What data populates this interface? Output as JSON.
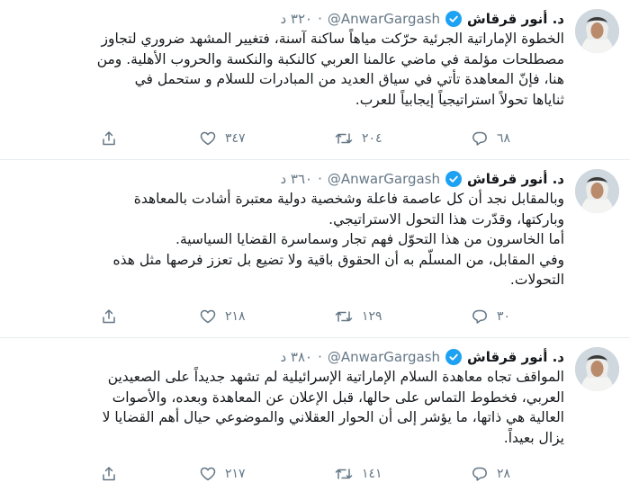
{
  "tweets": [
    {
      "author": {
        "name": "د. أنور قرقاش",
        "handle": "@AnwarGargash"
      },
      "separator": "·",
      "time": "٣٢٠ د",
      "text": "الخطوة الإماراتية الجرئية حرّكت مياهاً ساكنة آسنة، فتغيير المشهد ضروري لتجاوز\nمصطلحات مؤلمة في ماضي عالمنا العربي كالنكبة والنكسة والحروب الأهلية. ومن\nهنا، فإنّ المعاهدة تأتي في سياق العديد من المبادرات للسلام و ستحمل في\nثناياها تحولاً استراتيجياً إيجابياً للعرب.",
      "replies": "٦٨",
      "retweets": "٢٠٤",
      "likes": "٣٤٧"
    },
    {
      "author": {
        "name": "د. أنور قرقاش",
        "handle": "@AnwarGargash"
      },
      "separator": "·",
      "time": "٣٦٠ د",
      "text": "وبالمقابل نجد أن كل عاصمة فاعلة وشخصية دولية معتبرة أشادت بالمعاهدة\nوباركتها، وقدّرت هذا التحول الاستراتيجي.\nأما الخاسرون من هذا التحوّل فهم تجار وسماسرة القضايا السياسية.\nوفي المقابل، من المسلّم به أن الحقوق باقية ولا تضيع بل تعزز فرصها مثل هذه\nالتحولات.",
      "replies": "٣٠",
      "retweets": "١٢٩",
      "likes": "٢١٨"
    },
    {
      "author": {
        "name": "د. أنور قرقاش",
        "handle": "@AnwarGargash"
      },
      "separator": "·",
      "time": "٣٨٠ د",
      "text": "المواقف تجاه معاهدة السلام الإماراتية الإسرائيلية لم تشهد جديداً على الصعيدين\nالعربي، فخطوط التماس على حالها، قبل الإعلان عن المعاهدة وبعده، والأصوات\nالعالية هي ذاتها، ما يؤشر إلى أن  الحوار العقلاني والموضوعي حيال أهم القضايا لا\nيزال بعيداً.",
      "replies": "٢٨",
      "retweets": "١٤١",
      "likes": "٢١٧"
    }
  ],
  "colors": {
    "accent": "#1da1f2",
    "muted": "#657786",
    "border": "#e6ecf0",
    "text": "#14171a"
  },
  "icons": [
    "avatar",
    "verified-badge-icon",
    "reply-icon",
    "retweet-icon",
    "like-icon",
    "share-icon"
  ]
}
